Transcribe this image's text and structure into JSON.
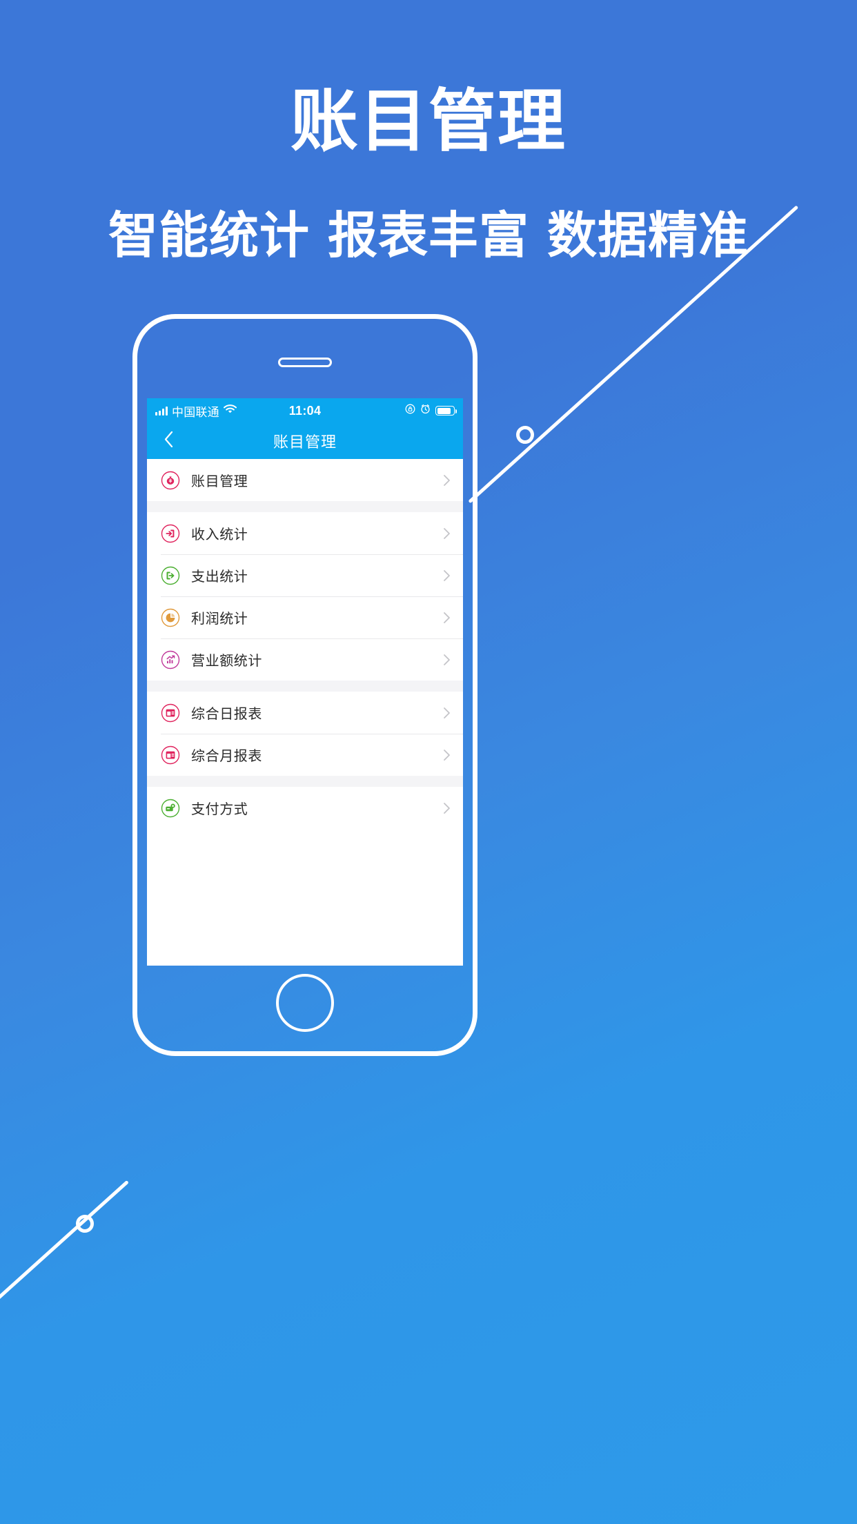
{
  "hero": {
    "title": "账目管理",
    "subtitle_parts": [
      "智能统计",
      "报表丰富",
      "数据精准"
    ]
  },
  "colors": {
    "bg_start": "#3c77d8",
    "bg_end": "#2d9ae9",
    "nav_bar": "#0aa7ee",
    "accent_red": "#e0245e",
    "accent_green": "#4caf32",
    "accent_orange": "#e09a3c",
    "accent_magenta": "#c0399a",
    "list_bg": "#f4f4f6",
    "row_text": "#2b2b2b"
  },
  "phone": {
    "status_bar": {
      "signal_icon": "signal-bars-icon",
      "carrier": "中国联通",
      "wifi_icon": "wifi-icon",
      "time": "11:04",
      "rotation_lock_icon": "rotation-lock-icon",
      "alarm_icon": "alarm-clock-icon",
      "battery_icon": "battery-icon"
    },
    "nav_bar": {
      "back_icon": "chevron-left-icon",
      "title": "账目管理"
    },
    "list_groups": [
      {
        "items": [
          {
            "icon": "money-bag-icon",
            "color": "#e0245e",
            "label": "账目管理",
            "chevron": "chevron-right-icon"
          }
        ]
      },
      {
        "items": [
          {
            "icon": "arrow-into-box-icon",
            "color": "#e0245e",
            "label": "收入统计",
            "chevron": "chevron-right-icon"
          },
          {
            "icon": "arrow-out-of-box-icon",
            "color": "#4caf32",
            "label": "支出统计",
            "chevron": "chevron-right-icon"
          },
          {
            "icon": "pie-chart-icon",
            "color": "#e09a3c",
            "label": "利润统计",
            "chevron": "chevron-right-icon"
          },
          {
            "icon": "trend-chart-icon",
            "color": "#c0399a",
            "label": "营业额统计",
            "chevron": "chevron-right-icon"
          }
        ]
      },
      {
        "items": [
          {
            "icon": "daily-report-icon",
            "color": "#e0245e",
            "label": "综合日报表",
            "chevron": "chevron-right-icon"
          },
          {
            "icon": "monthly-report-icon",
            "color": "#e0245e",
            "label": "综合月报表",
            "chevron": "chevron-right-icon"
          }
        ]
      },
      {
        "items": [
          {
            "icon": "payment-card-icon",
            "color": "#4caf32",
            "label": "支付方式",
            "chevron": "chevron-right-icon"
          }
        ]
      }
    ]
  }
}
